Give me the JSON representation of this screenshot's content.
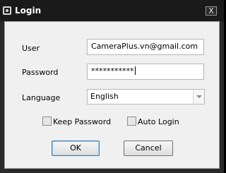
{
  "window": {
    "title": "Login",
    "close_glyph": "X",
    "app_icon": "camera-app-icon"
  },
  "form": {
    "user_label": "User",
    "user_value": "CameraPlus.vn@gmail.com",
    "password_label": "Password",
    "password_value": "***********",
    "language_label": "Language",
    "language_value": "English"
  },
  "options": {
    "keep_password_label": "Keep Password",
    "keep_password_checked": false,
    "auto_login_label": "Auto Login",
    "auto_login_checked": false
  },
  "buttons": {
    "ok_label": "OK",
    "cancel_label": "Cancel"
  },
  "colors": {
    "titlebar": "#1a1a1a",
    "dialog_bg": "#f0f0f0",
    "default_button_border": "#3c7fb1"
  }
}
